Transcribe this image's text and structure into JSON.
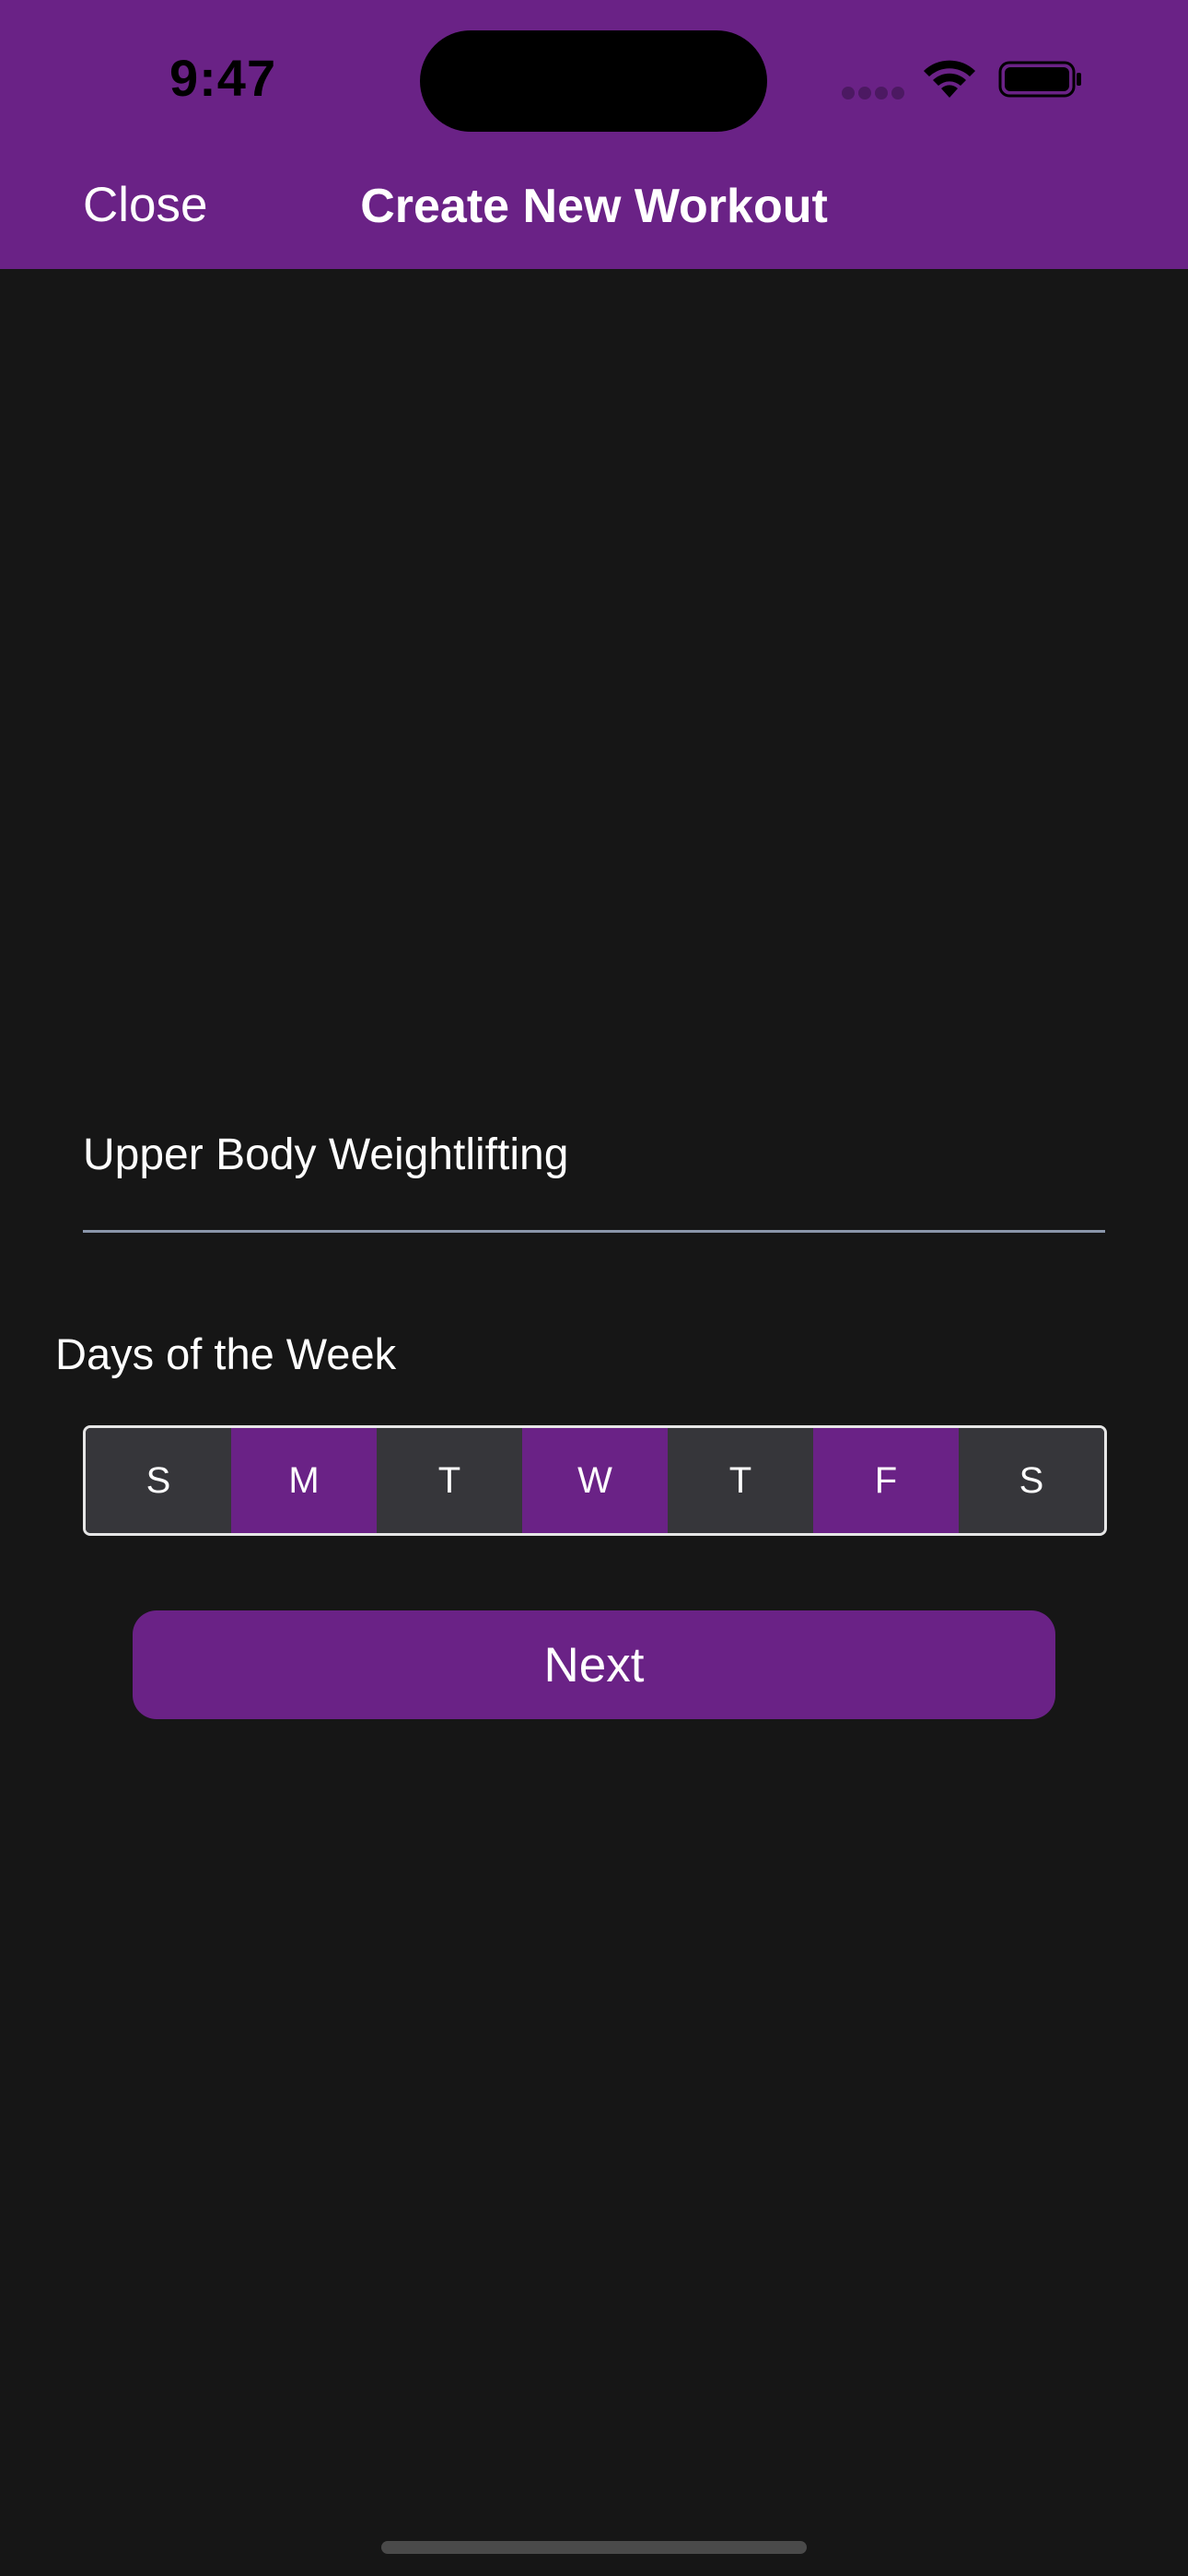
{
  "status_bar": {
    "time": "9:47"
  },
  "nav": {
    "close_label": "Close",
    "title": "Create New Workout"
  },
  "form": {
    "workout_name": {
      "value": "Upper Body Weightlifting",
      "placeholder": ""
    },
    "days_label": "Days of the Week",
    "days": [
      {
        "label": "S",
        "selected": false
      },
      {
        "label": "M",
        "selected": true
      },
      {
        "label": "T",
        "selected": false
      },
      {
        "label": "W",
        "selected": true
      },
      {
        "label": "T",
        "selected": false
      },
      {
        "label": "F",
        "selected": true
      },
      {
        "label": "S",
        "selected": false
      }
    ],
    "next_label": "Next"
  },
  "colors": {
    "accent": "#6a2286",
    "background": "#161616",
    "unselected_day": "#36363a"
  },
  "icons": [
    "cellular-signal-icon",
    "wifi-icon",
    "battery-icon"
  ]
}
